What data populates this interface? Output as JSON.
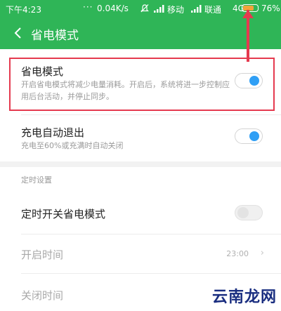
{
  "statusbar": {
    "time": "下午4:23",
    "dots": "···",
    "speed": "0.04K/s",
    "carrier1": "移动",
    "carrier2": "联通",
    "network": "4G",
    "battery_percent_text": "76%",
    "battery_level": 0.76
  },
  "appbar": {
    "title": "省电模式",
    "back_icon": "chevron-left-icon"
  },
  "power_saving": {
    "title": "省电模式",
    "description": "开启省电模式将减少电量消耗。开启后，系统将进一步控制应用后台活动，并停止同步。",
    "enabled": true
  },
  "auto_exit": {
    "title": "充电自动退出",
    "description": "充电至60%或充满时自动关闭",
    "enabled": true
  },
  "schedule": {
    "header": "定时设置",
    "toggle_title": "定时开关省电模式",
    "toggle_enabled": false,
    "start_label": "开启时间",
    "start_value": "23:00",
    "end_label": "关闭时间"
  },
  "watermark": "云南龙网",
  "colors": {
    "green": "#2fb557",
    "toggle_blue": "#2f9ff5",
    "annotation_red": "#e53a4f"
  }
}
